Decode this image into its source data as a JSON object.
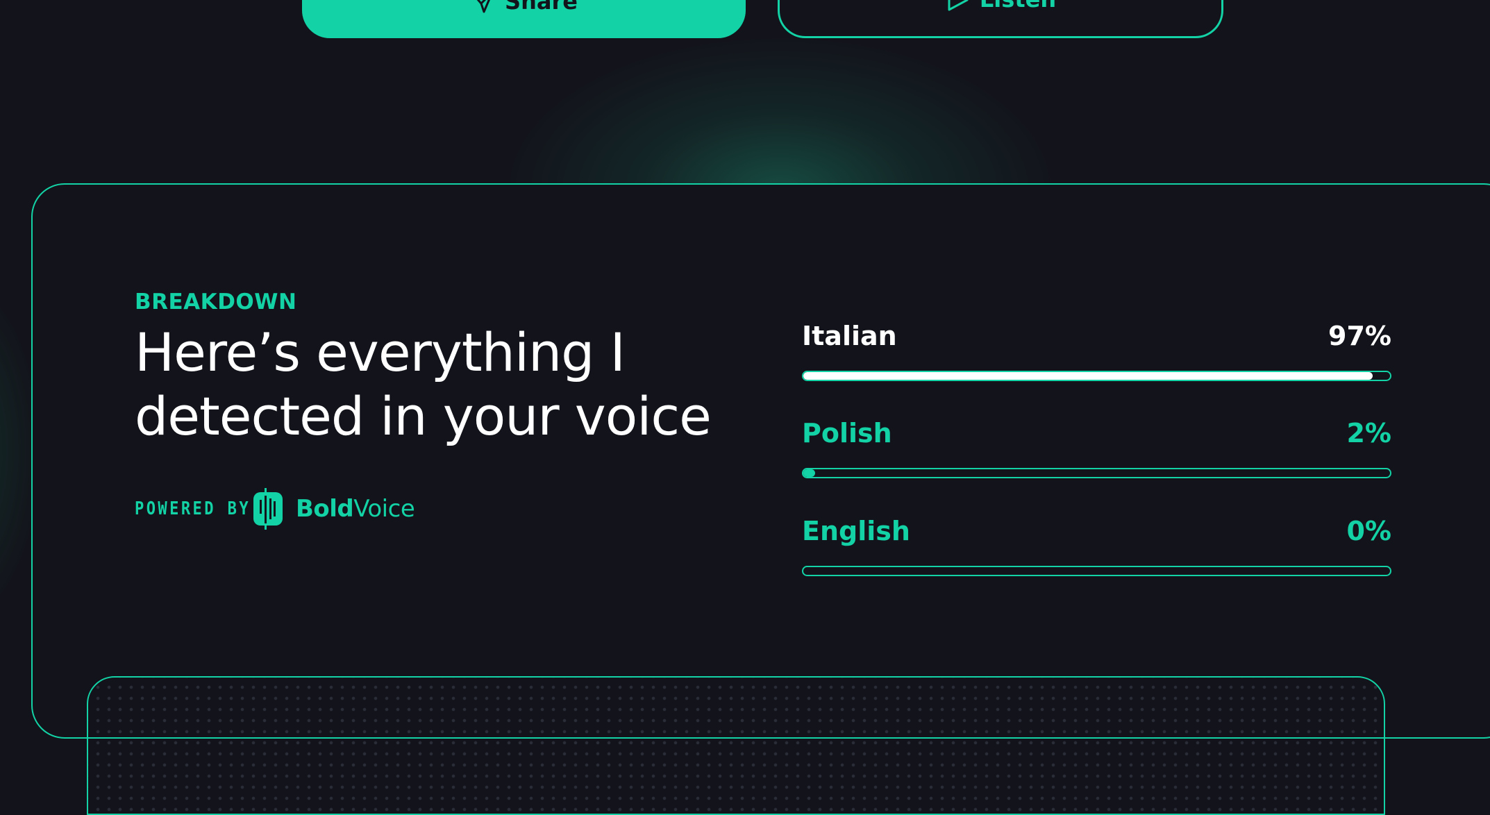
{
  "actions": {
    "share_label": "Share",
    "listen_label": "Listen"
  },
  "breakdown": {
    "eyebrow": "BREAKDOWN",
    "headline_line1": "Here’s everything I",
    "headline_line2": "detected in your voice",
    "powered_by": "POWERED BY",
    "brand_bold": "Bold",
    "brand_regular": "Voice"
  },
  "languages": [
    {
      "name": "Italian",
      "percent_label": "97%",
      "fraction": 0.97
    },
    {
      "name": "Polish",
      "percent_label": "2%",
      "fraction": 0.02
    },
    {
      "name": "English",
      "percent_label": "0%",
      "fraction": 0.0
    }
  ],
  "colors": {
    "accent": "#13d3a6",
    "background": "#13141b",
    "top_language": "#ffffff"
  },
  "icons": {
    "share": "paper-plane-icon",
    "listen": "play-icon",
    "brand": "boldvoice-logo"
  }
}
